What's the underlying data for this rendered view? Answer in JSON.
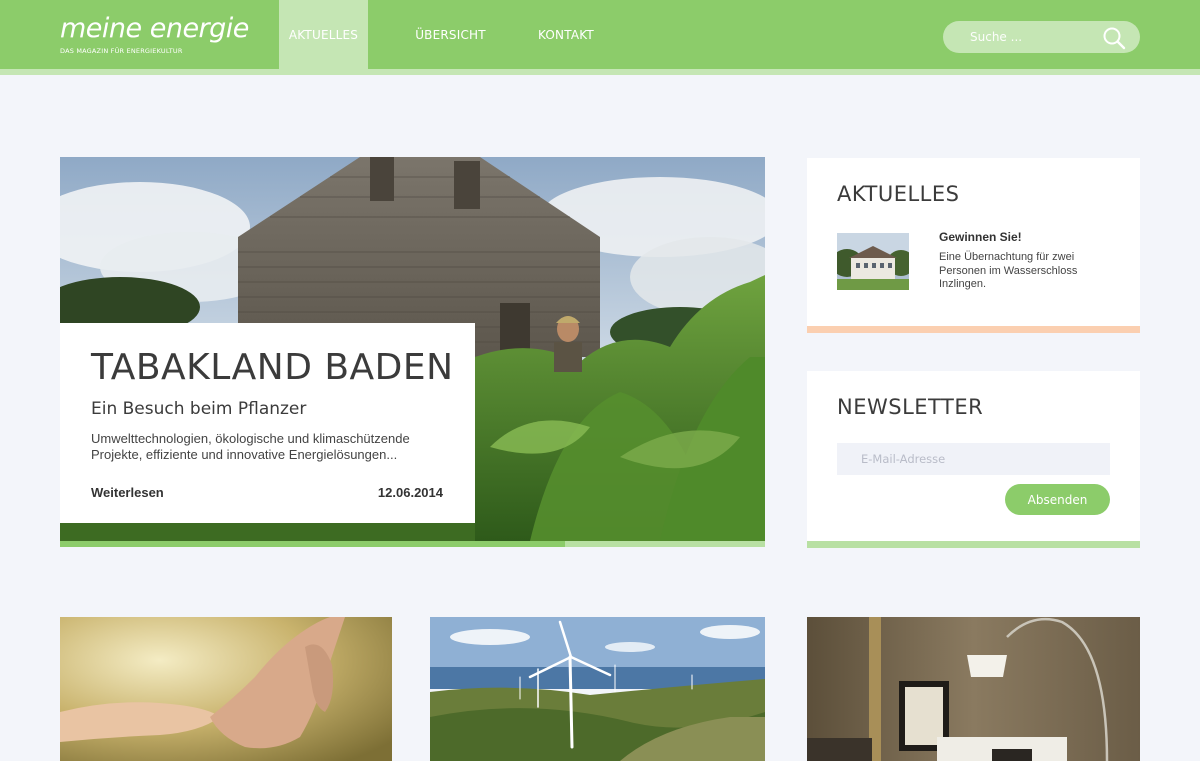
{
  "header": {
    "logo_title": "meine energie",
    "logo_subtitle": "DAS MAGAZIN FÜR ENERGIEKULTUR",
    "nav": [
      {
        "label": "AKTUELLES",
        "active": true
      },
      {
        "label": "ÜBERSICHT",
        "active": false
      },
      {
        "label": "KONTAKT",
        "active": false
      }
    ],
    "search_placeholder": "Suche ..."
  },
  "hero": {
    "title": "TABAKLAND BADEN",
    "subtitle": "Ein Besuch beim Pflanzer",
    "text": "Umwelttechnologien, ökologische und klimaschützende Projekte, effiziente und innovative Energielösungen...",
    "more_label": "Weiterlesen",
    "date": "12.06.2014"
  },
  "news": {
    "title": "AKTUELLES",
    "item_title": "Gewinnen Sie!",
    "item_text": "Eine Übernachtung für zwei Personen im Wasserschloss Inzlingen."
  },
  "newsletter": {
    "title": "NEWSLETTER",
    "email_placeholder": "E-Mail-Adresse",
    "submit_label": "Absenden"
  },
  "colors": {
    "brand_green": "#8ccc6a",
    "light_green": "#c5e6b4",
    "peach": "#fbcfb0",
    "background": "#f3f5fa"
  },
  "icons": {
    "search": "search-icon"
  }
}
